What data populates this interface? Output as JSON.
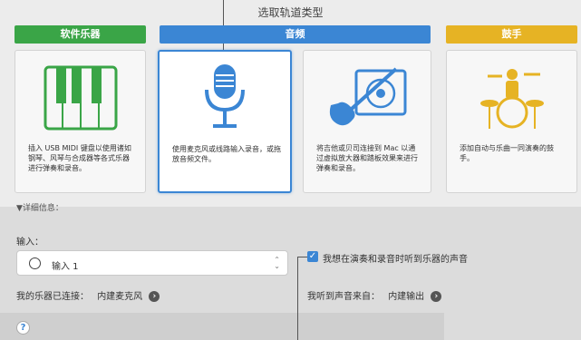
{
  "dialog": {
    "title": "选取轨道类型"
  },
  "categories": [
    {
      "label": "软件乐器",
      "color": "#3aa547"
    },
    {
      "label": "音频",
      "color": "#3b86d4"
    },
    {
      "label": "鼓手",
      "color": "#e6b324"
    }
  ],
  "cards": [
    {
      "desc": "插入 USB MIDI 键盘以使用诸如钢琴、风琴与合成器等各式乐器进行弹奏和录音。",
      "icon": "piano-keys-icon"
    },
    {
      "desc": "使用麦克风或线路输入录音，或拖放音频文件。",
      "icon": "microphone-icon"
    },
    {
      "desc": "将吉他或贝司连接到 Mac 以通过虚拟放大器和踏板效果来进行弹奏和录音。",
      "icon": "guitar-amp-icon"
    },
    {
      "desc": "添加自动与乐曲一同演奏的鼓手。",
      "icon": "drummer-icon"
    }
  ],
  "details": {
    "toggle_label": "▼详细信息："
  },
  "input": {
    "label": "输入：",
    "selected": "输入 1",
    "connected_label": "我的乐器已连接：",
    "connected_value": "内建麦克风"
  },
  "monitor": {
    "checkbox_label": "我想在演奏和录音时听到乐器的声音",
    "checked": true,
    "source_label": "我听到声音来自：",
    "source_value": "内建输出"
  },
  "help": {
    "label": "?"
  },
  "colors": {
    "accent": "#3b86d4",
    "icon_green": "#3aa547",
    "icon_blue": "#3b86d4",
    "icon_gold": "#e6b324"
  }
}
